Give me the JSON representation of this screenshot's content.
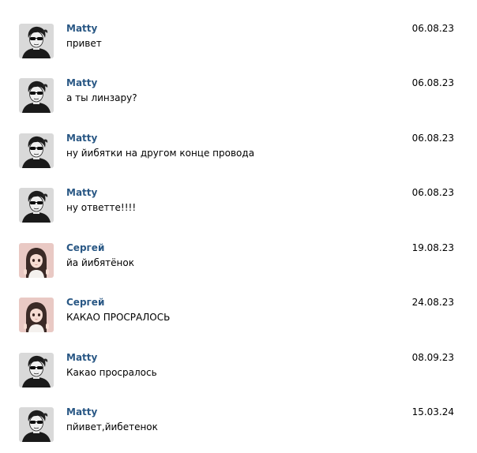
{
  "messages": [
    {
      "author": "Matty",
      "avatar": "matty-avatar",
      "text": "привет",
      "date": "06.08.23"
    },
    {
      "author": "Matty",
      "avatar": "matty-avatar",
      "text": "а ты линзару?",
      "date": "06.08.23"
    },
    {
      "author": "Matty",
      "avatar": "matty-avatar",
      "text": "ну йибятки на другом конце провода",
      "date": "06.08.23"
    },
    {
      "author": "Matty",
      "avatar": "matty-avatar",
      "text": "ну ответте!!!!",
      "date": "06.08.23"
    },
    {
      "author": "Сергей",
      "avatar": "sergey-avatar",
      "text": "йа йибятёнок",
      "date": "19.08.23"
    },
    {
      "author": "Сергей",
      "avatar": "sergey-avatar",
      "text": "КАКАО ПРОСРАЛОСЬ",
      "date": "24.08.23"
    },
    {
      "author": "Matty",
      "avatar": "matty-avatar",
      "text": "Какао просралось",
      "date": "08.09.23"
    },
    {
      "author": "Matty",
      "avatar": "matty-avatar",
      "text": "пйивет,йибетенок",
      "date": "15.03.24"
    }
  ],
  "colors": {
    "author_link": "#2a5885",
    "text": "#000000",
    "background": "#ffffff"
  }
}
